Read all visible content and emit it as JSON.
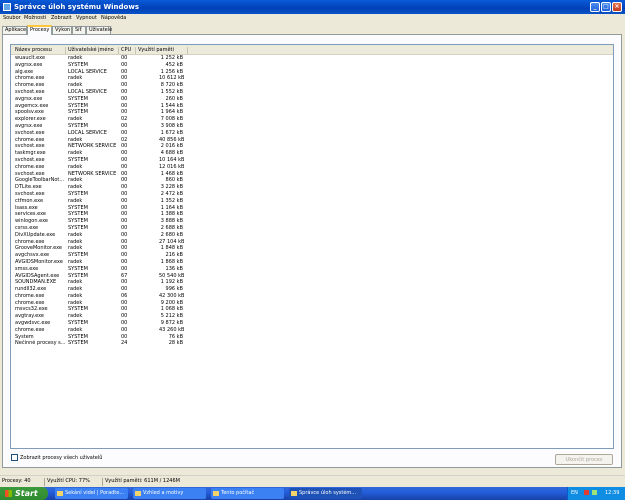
{
  "window": {
    "title": "Správce úloh systému Windows"
  },
  "menu": [
    "Soubor",
    "Možnosti",
    "Zobrazit",
    "Vypnout",
    "Nápověda"
  ],
  "tabs": [
    "Aplikace",
    "Procesy",
    "Výkon",
    "Síť",
    "Uživatelé"
  ],
  "active_tab": "Procesy",
  "columns": {
    "name": "Název procesu",
    "user": "Uživatelské jméno",
    "cpu": "CPU",
    "mem": "Využití paměti"
  },
  "processes": [
    [
      "wuauclt.exe",
      "radek",
      "00",
      "1 252 kB"
    ],
    [
      "avgrsx.exe",
      "SYSTEM",
      "00",
      "452 kB"
    ],
    [
      "alg.exe",
      "LOCAL SERVICE",
      "00",
      "1 256 kB"
    ],
    [
      "chrome.exe",
      "radek",
      "00",
      "10 612 kB"
    ],
    [
      "chrome.exe",
      "radek",
      "00",
      "8 720 kB"
    ],
    [
      "svchost.exe",
      "LOCAL SERVICE",
      "00",
      "1 552 kB"
    ],
    [
      "avgrsx.exe",
      "SYSTEM",
      "00",
      "260 kB"
    ],
    [
      "avgemcx.exe",
      "SYSTEM",
      "00",
      "1 544 kB"
    ],
    [
      "spoolsv.exe",
      "SYSTEM",
      "00",
      "1 964 kB"
    ],
    [
      "explorer.exe",
      "radek",
      "02",
      "7 008 kB"
    ],
    [
      "avgrsx.exe",
      "SYSTEM",
      "00",
      "3 908 kB"
    ],
    [
      "svchost.exe",
      "LOCAL SERVICE",
      "00",
      "1 672 kB"
    ],
    [
      "chrome.exe",
      "radek",
      "02",
      "40 856 kB"
    ],
    [
      "svchost.exe",
      "NETWORK SERVICE",
      "00",
      "2 016 kB"
    ],
    [
      "taskmgr.exe",
      "radek",
      "00",
      "4 688 kB"
    ],
    [
      "svchost.exe",
      "SYSTEM",
      "00",
      "10 164 kB"
    ],
    [
      "chrome.exe",
      "radek",
      "00",
      "12 016 kB"
    ],
    [
      "svchost.exe",
      "NETWORK SERVICE",
      "00",
      "1 468 kB"
    ],
    [
      "GoogleToolbarNot...",
      "radek",
      "00",
      "860 kB"
    ],
    [
      "DTLite.exe",
      "radek",
      "00",
      "3 228 kB"
    ],
    [
      "svchost.exe",
      "SYSTEM",
      "00",
      "2 472 kB"
    ],
    [
      "ctfmon.exe",
      "radek",
      "00",
      "1 352 kB"
    ],
    [
      "lsass.exe",
      "SYSTEM",
      "00",
      "1 164 kB"
    ],
    [
      "services.exe",
      "SYSTEM",
      "00",
      "1 388 kB"
    ],
    [
      "winlogon.exe",
      "SYSTEM",
      "00",
      "3 888 kB"
    ],
    [
      "csrss.exe",
      "SYSTEM",
      "00",
      "2 688 kB"
    ],
    [
      "DivXUpdate.exe",
      "radek",
      "00",
      "2 680 kB"
    ],
    [
      "chrome.exe",
      "radek",
      "00",
      "27 104 kB"
    ],
    [
      "GrooveMonitor.exe",
      "radek",
      "00",
      "1 848 kB"
    ],
    [
      "avgchsvx.exe",
      "SYSTEM",
      "00",
      "216 kB"
    ],
    [
      "AVGIDSMonitor.exe",
      "radek",
      "00",
      "1 868 kB"
    ],
    [
      "smss.exe",
      "SYSTEM",
      "00",
      "136 kB"
    ],
    [
      "AVGIDSAgent.exe",
      "SYSTEM",
      "67",
      "50 540 kB"
    ],
    [
      "SOUNDMAN.EXE",
      "radek",
      "00",
      "1 192 kB"
    ],
    [
      "rundll32.exe",
      "radek",
      "00",
      "996 kB"
    ],
    [
      "chrome.exe",
      "radek",
      "06",
      "42 300 kB"
    ],
    [
      "chrome.exe",
      "radek",
      "00",
      "9 200 kB"
    ],
    [
      "msvcs32.exe",
      "SYSTEM",
      "00",
      "1 068 kB"
    ],
    [
      "avgtray.exe",
      "radek",
      "00",
      "5 212 kB"
    ],
    [
      "avgwdsvc.exe",
      "SYSTEM",
      "00",
      "9 872 kB"
    ],
    [
      "chrome.exe",
      "radek",
      "00",
      "43 260 kB"
    ],
    [
      "System",
      "SYSTEM",
      "00",
      "76 kB"
    ],
    [
      "Nečinné procesy s...",
      "SYSTEM",
      "24",
      "28 kB"
    ]
  ],
  "show_all_label": "Zobrazit procesy všech uživatelů",
  "end_process_label": "Ukončit proces",
  "status": {
    "processes": "Procesy: 40",
    "cpu": "Využití CPU: 77%",
    "memory": "Využití paměti: 611M / 1246M"
  },
  "taskbar": {
    "start_label": "Start",
    "tasks": [
      "Sekání videí | Poradte...",
      "Vzhled a motivy",
      "Tento počítač",
      "Správce úloh systém..."
    ],
    "lang": "EN",
    "clock": "12:39"
  }
}
